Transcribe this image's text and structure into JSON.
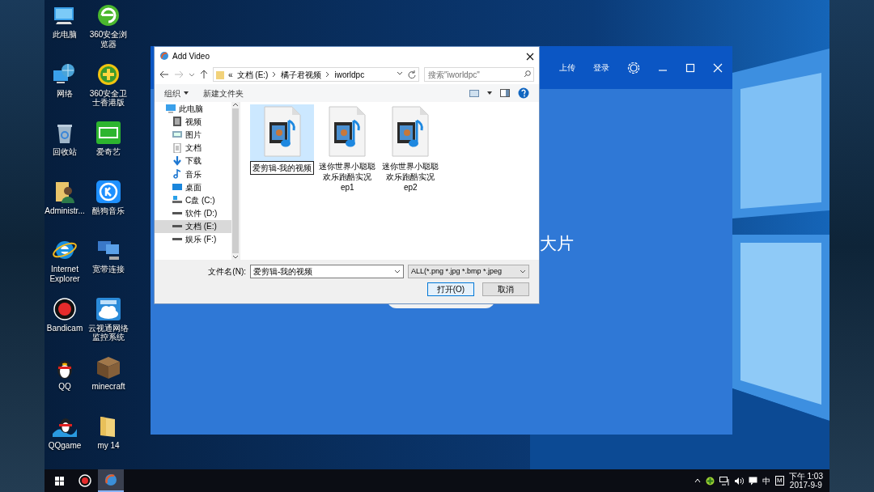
{
  "desktop_icons": [
    {
      "label": "此电脑",
      "kind": "computer"
    },
    {
      "label": "360安全浏览器",
      "kind": "browser360"
    },
    {
      "label": "网络",
      "kind": "network"
    },
    {
      "label": "360安全卫士香港版",
      "kind": "guard360"
    },
    {
      "label": "回收站",
      "kind": "recycle"
    },
    {
      "label": "爱奇艺",
      "kind": "iqiyi"
    },
    {
      "label": "Administr...",
      "kind": "userfolder"
    },
    {
      "label": "酷狗音乐",
      "kind": "kugou"
    },
    {
      "label": "Internet Explorer",
      "kind": "ie"
    },
    {
      "label": "宽带连接",
      "kind": "broadband"
    },
    {
      "label": "Bandicam",
      "kind": "bandicam"
    },
    {
      "label": "云视通网络监控系统",
      "kind": "cloud"
    },
    {
      "label": "QQ",
      "kind": "qq"
    },
    {
      "label": "minecraft",
      "kind": "minecraft"
    },
    {
      "label": "QQgame",
      "kind": "qqgame"
    },
    {
      "label": "my 14",
      "kind": "folder"
    }
  ],
  "app_window": {
    "header_links": [
      "上传",
      "登录"
    ],
    "hero_text": "大片"
  },
  "dialog": {
    "title": "Add Video",
    "breadcrumb": [
      "«",
      "文档 (E:)",
      "橘子君视频",
      "iworldpc"
    ],
    "search": {
      "placeholder": "搜索\"iworldpc\""
    },
    "toolbar": [
      "组织",
      "新建文件夹"
    ],
    "nav_tree": [
      {
        "label": "此电脑",
        "kind": "pc",
        "selected": false,
        "children": [
          {
            "label": "视频",
            "kind": "video",
            "selected": false
          },
          {
            "label": "图片",
            "kind": "pictures",
            "selected": false
          },
          {
            "label": "文档",
            "kind": "docs",
            "selected": false
          },
          {
            "label": "下载",
            "kind": "downloads",
            "selected": false
          },
          {
            "label": "音乐",
            "kind": "music",
            "selected": false
          },
          {
            "label": "桌面",
            "kind": "desktop",
            "selected": false
          },
          {
            "label": "C盘 (C:)",
            "kind": "systemdrive",
            "selected": false
          },
          {
            "label": "软件 (D:)",
            "kind": "drive",
            "selected": false
          },
          {
            "label": "文档 (E:)",
            "kind": "drive",
            "selected": true
          },
          {
            "label": "娱乐 (F:)",
            "kind": "drive",
            "selected": false
          }
        ]
      }
    ],
    "files": [
      {
        "label": "爱剪辑-我的视频",
        "selected": true
      },
      {
        "label": "迷你世界小聪聪欢乐跑酷实况ep1",
        "selected": false
      },
      {
        "label": "迷你世界小聪聪欢乐跑酷实况ep2",
        "selected": false
      }
    ],
    "filename_label": "文件名(N):",
    "filename": "爱剪辑-我的视频",
    "file_type": "ALL(*.png *.jpg *.bmp *.jpeg",
    "buttons": [
      {
        "label": "打开(O)",
        "default": true
      },
      {
        "label": "取消",
        "default": false
      }
    ]
  },
  "taskbar": {
    "apps": [
      {
        "kind": "start",
        "active": false
      },
      {
        "kind": "record",
        "active": false
      },
      {
        "kind": "app",
        "active": true
      }
    ],
    "tray": [
      "中",
      "M"
    ],
    "time": "下午 1:03",
    "date": "2017-9-9"
  }
}
